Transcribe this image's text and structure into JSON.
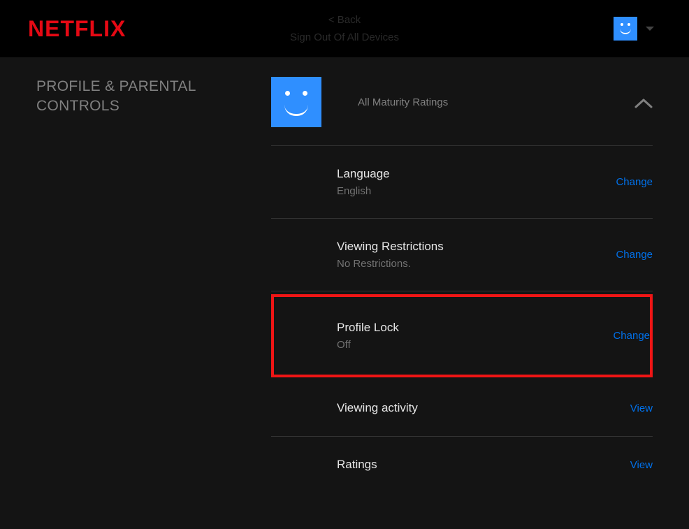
{
  "brand": {
    "logo_text": "NETFLIX",
    "accent_color": "#e50914",
    "link_color": "#0071eb",
    "highlight_color": "#ef1515"
  },
  "header": {
    "faded_line1": "< Back",
    "faded_line2": "Sign Out Of All Devices"
  },
  "sidebar": {
    "title": "PROFILE & PARENTAL CONTROLS"
  },
  "profile": {
    "name": "",
    "maturity": "All Maturity Ratings",
    "avatar_icon": "smiley-avatar"
  },
  "settings": [
    {
      "key": "language",
      "title": "Language",
      "value": "English",
      "action": "Change"
    },
    {
      "key": "viewing-restrictions",
      "title": "Viewing Restrictions",
      "value": "No Restrictions.",
      "action": "Change"
    },
    {
      "key": "profile-lock",
      "title": "Profile Lock",
      "value": "Off",
      "action": "Change",
      "highlighted": true
    },
    {
      "key": "viewing-activity",
      "title": "Viewing activity",
      "value": "",
      "action": "View"
    },
    {
      "key": "ratings",
      "title": "Ratings",
      "value": "",
      "action": "View"
    }
  ]
}
